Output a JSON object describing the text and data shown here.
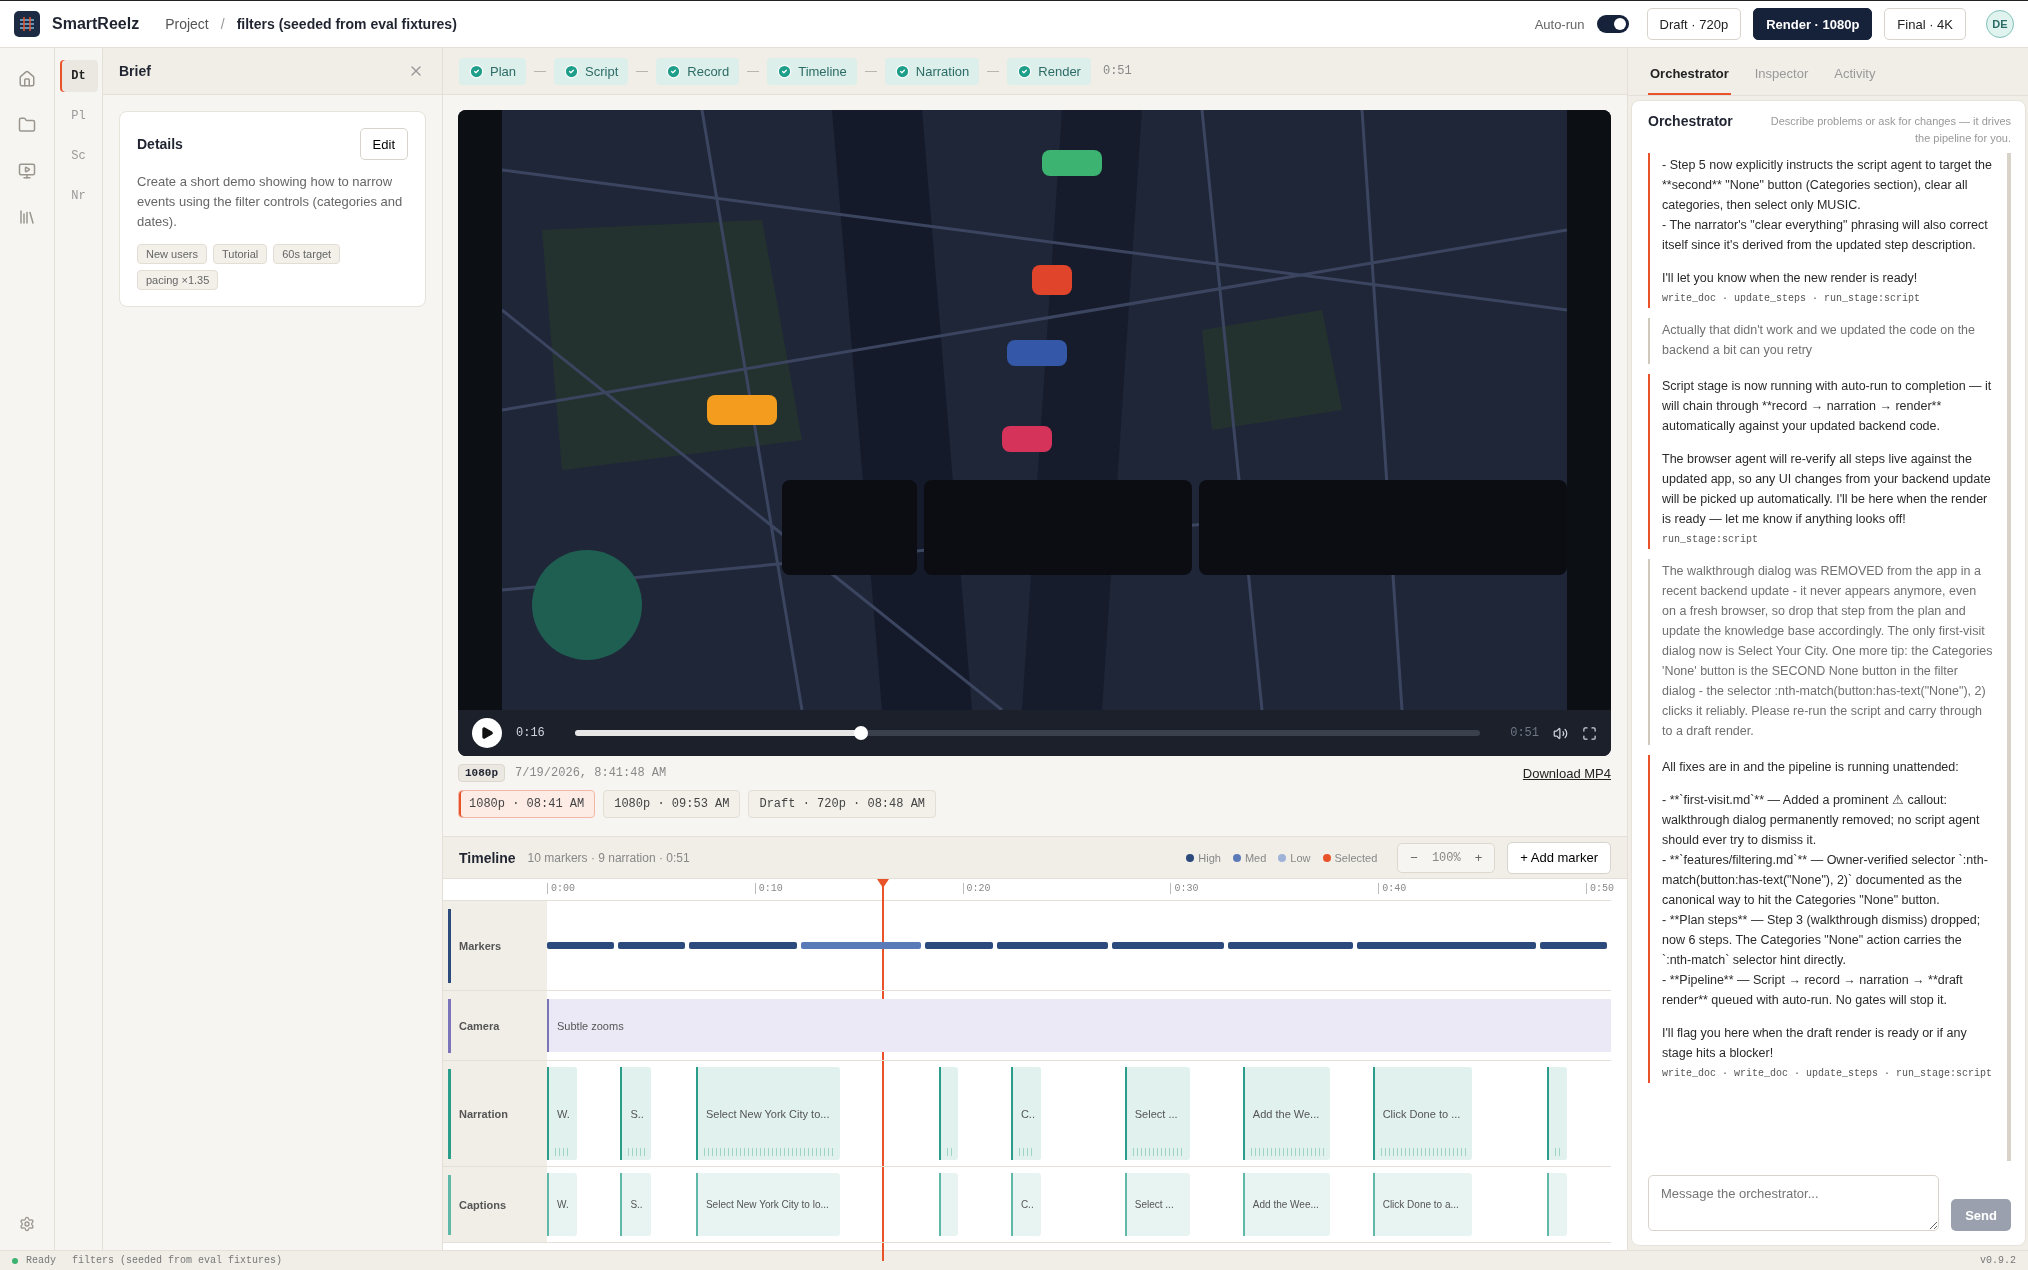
{
  "app": {
    "name": "SmartReelz"
  },
  "breadcrumb": {
    "items": [
      "Project",
      "filters (seeded from eval fixtures)"
    ],
    "separator": "/"
  },
  "auto_run": {
    "label": "Auto-run",
    "on": true
  },
  "quality": [
    {
      "label": "Draft · 720p",
      "selected": false
    },
    {
      "label": "Render · 1080p",
      "selected": true
    },
    {
      "label": "Final · 4K",
      "selected": false
    }
  ],
  "user": {
    "initials": "DE"
  },
  "sections": [
    {
      "label": "Dt",
      "selected": true
    },
    {
      "label": "Pl",
      "selected": false
    },
    {
      "label": "Sc",
      "selected": false
    },
    {
      "label": "Nr",
      "selected": false
    }
  ],
  "brief": {
    "title": "Brief",
    "details": {
      "title": "Details",
      "edit": "Edit",
      "description": "Create a short demo showing how to narrow events using the filter controls (categories and dates).",
      "tags": [
        "New users",
        "Tutorial",
        "60s target",
        "pacing ×1.35"
      ]
    }
  },
  "steps": {
    "items": [
      {
        "label": "Plan",
        "done": true
      },
      {
        "label": "Script",
        "done": true
      },
      {
        "label": "Record",
        "done": true
      },
      {
        "label": "Timeline",
        "done": true
      },
      {
        "label": "Narration",
        "done": true
      },
      {
        "label": "Render",
        "done": true
      }
    ],
    "duration": "0:51"
  },
  "player": {
    "kind": "picture",
    "time": "0:16",
    "duration": "0:51",
    "level": 0.316
  },
  "render": {
    "resolution": "1080p",
    "timestamp": "7/19/2026, 8:41:48 AM",
    "download": "Download MP4",
    "versions": [
      {
        "label": "1080p · 08:41 AM",
        "selected": true
      },
      {
        "label": "1080p · 09:53 AM",
        "selected": false
      },
      {
        "label": "Draft · 720p · 08:48 AM",
        "selected": false
      }
    ]
  },
  "timeline": {
    "title": "Timeline",
    "summary": "10 markers · 9 narration · 0:51",
    "legend": [
      {
        "label": "High",
        "color": "#2c4a7c"
      },
      {
        "label": "Med",
        "color": "#5b7bb8"
      },
      {
        "label": "Low",
        "color": "#9fb3d8"
      },
      {
        "label": "Selected",
        "color": "#e8532a"
      }
    ],
    "zoom": {
      "minus": "−",
      "value": "100%",
      "plus": "+"
    },
    "add_marker": "+ Add marker",
    "ticks": [
      "0:00",
      "0:10",
      "0:20",
      "0:30",
      "0:40",
      "0:50"
    ],
    "tracks": [
      {
        "kind": "markers",
        "label": "Markers",
        "color": "#2c4a7c",
        "markers": [
          {
            "color": "#2c4a7c"
          },
          {
            "color": "#2c4a7c"
          },
          {
            "color": "#2c4a7c"
          },
          {
            "color": "#5b7bb8"
          },
          {
            "color": "#2c4a7c"
          },
          {
            "color": "#2c4a7c"
          },
          {
            "color": "#2c4a7c"
          },
          {
            "color": "#2c4a7c"
          },
          {
            "color": "#2c4a7c"
          },
          {
            "color": "#2c4a7c"
          }
        ]
      },
      {
        "kind": "camera",
        "label": "Camera",
        "color": "#7b74b8",
        "clips": [
          {
            "label": "Subtle zooms"
          }
        ]
      },
      {
        "kind": "narration",
        "label": "Narration",
        "color": "#2a9d8a",
        "clips": [
          {
            "kind": "text",
            "label": "W."
          },
          {
            "kind": "text",
            "label": "S.."
          },
          {
            "kind": "text",
            "label": "Select New York City to..."
          },
          {
            "kind": "blank"
          },
          {
            "kind": "text",
            "label": "C.."
          },
          {
            "kind": "text",
            "label": "Select ..."
          },
          {
            "kind": "text",
            "label": "Add the We..."
          },
          {
            "kind": "text",
            "label": "Click Done to ..."
          },
          {
            "kind": "blank"
          }
        ]
      },
      {
        "kind": "captions",
        "label": "Captions",
        "color": "#5fb8a8",
        "clips": [
          {
            "kind": "text",
            "label": "W."
          },
          {
            "kind": "text",
            "label": "S.."
          },
          {
            "kind": "text",
            "label": "Select New York City to lo..."
          },
          {
            "kind": "blank"
          },
          {
            "kind": "text",
            "label": "C.."
          },
          {
            "kind": "text",
            "label": "Select ..."
          },
          {
            "kind": "text",
            "label": "Add the Wee..."
          },
          {
            "kind": "text",
            "label": "Click Done to a..."
          },
          {
            "kind": "blank"
          }
        ]
      }
    ]
  },
  "panel": {
    "tabs": [
      {
        "label": "Orchestrator",
        "selected": true
      },
      {
        "label": "Inspector",
        "selected": false
      },
      {
        "label": "Activity",
        "selected": false
      }
    ],
    "title": "Orchestrator",
    "hint": "Describe problems or ask for changes — it drives the pipeline for you.",
    "messages": [
      {
        "kind": "assistant",
        "blocks": [
          [
            "- Step 5 now explicitly instructs the script agent to target the **second** \"None\" button (Categories section), clear all categories, then select only MUSIC.",
            "- The narrator's \"clear everything\" phrasing will also correct itself since it's derived from the updated step description."
          ],
          [
            "I'll let you know when the new render is ready!"
          ]
        ],
        "tools": "write_doc · update_steps · run_stage:script"
      },
      {
        "kind": "user",
        "blocks": [
          [
            "Actually that didn't work and we updated the code on the backend a bit can you retry"
          ]
        ]
      },
      {
        "kind": "assistant",
        "blocks": [
          [
            "Script stage is now running with auto-run to completion — it will chain through **record → narration → render** automatically against your updated backend code."
          ],
          [
            "The browser agent will re-verify all steps live against the updated app, so any UI changes from your backend update will be picked up automatically. I'll be here when the render is ready — let me know if anything looks off!"
          ]
        ],
        "tools": "run_stage:script"
      },
      {
        "kind": "user",
        "blocks": [
          [
            "The walkthrough dialog was REMOVED from the app in a recent backend update - it never appears anymore, even on a fresh browser, so drop that step from the plan and update the knowledge base accordingly. The only first-visit dialog now is Select Your City. One more tip: the Categories 'None' button is the SECOND None button in the filter dialog - the selector :nth-match(button:has-text(\"None\"), 2) clicks it reliably. Please re-run the script and carry through to a draft render."
          ]
        ]
      },
      {
        "kind": "assistant",
        "blocks": [
          [
            "All fixes are in and the pipeline is running unattended:"
          ],
          [
            "- **`first-visit.md`** — Added a prominent ⚠ callout: walkthrough dialog permanently removed; no script agent should ever try to dismiss it.",
            "- **`features/filtering.md`** — Owner-verified selector `:nth-match(button:has-text(\"None\"), 2)` documented as the canonical way to hit the Categories \"None\" button.",
            "- **Plan steps** — Step 3 (walkthrough dismiss) dropped; now 6 steps. The Categories \"None\" action carries the `:nth-match` selector hint directly.",
            "- **Pipeline** — Script → record → narration → **draft render** queued with auto-run. No gates will stop it."
          ],
          [
            "I'll flag you here when the draft render is ready or if any stage hits a blocker!"
          ]
        ],
        "tools": "write_doc · write_doc · update_steps · run_stage:script"
      }
    ],
    "input": {
      "placeholder": "Message the orchestrator..."
    },
    "send": {
      "label": "Send",
      "disabled": true
    }
  },
  "status": {
    "state": "Ready",
    "project": "filters (seeded from eval fixtures)",
    "version": "v0.9.2"
  }
}
